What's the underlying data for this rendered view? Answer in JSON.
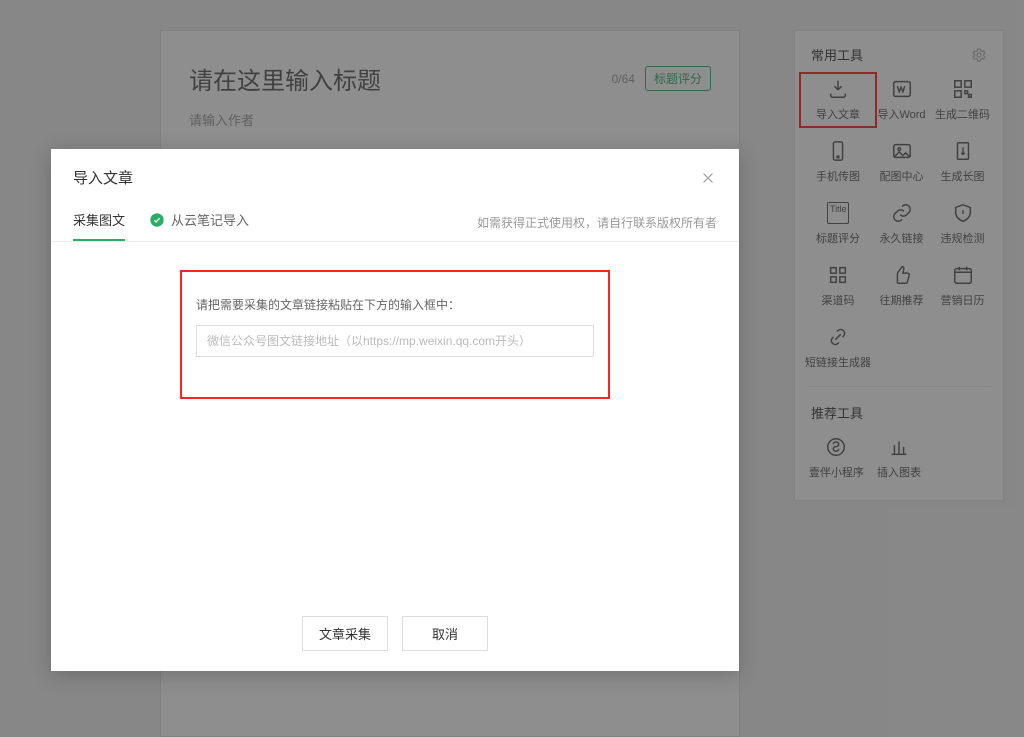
{
  "editor": {
    "title_placeholder": "请在这里输入标题",
    "author_placeholder": "请输入作者",
    "char_count": "0/64",
    "title_score_btn": "标题评分"
  },
  "sidebar": {
    "common_title": "常用工具",
    "recommend_title": "推荐工具",
    "tools": {
      "import_article": "导入文章",
      "import_word": "导入Word",
      "gen_qr": "生成二维码",
      "phone_upload": "手机传图",
      "image_center": "配图中心",
      "gen_long_image": "生成长图",
      "title_score": "标题评分",
      "perm_link": "永久链接",
      "violation_check": "违规检测",
      "channel_code": "渠道码",
      "past_recommend": "往期推荐",
      "marketing_calendar": "营销日历",
      "short_link_gen": "短链接生成器",
      "yiban_miniprogram": "壹伴小程序",
      "insert_chart": "插入图表"
    }
  },
  "modal": {
    "title": "导入文章",
    "tabs": {
      "collect": "采集图文",
      "import_note": "从云笔记导入"
    },
    "rights_hint": "如需获得正式使用权，请自行联系版权所有者",
    "collect_label": "请把需要采集的文章链接粘贴在下方的输入框中：",
    "collect_placeholder": "微信公众号图文链接地址（以https://mp.weixin.qq.com开头）",
    "url_value": "",
    "btn_collect": "文章采集",
    "btn_cancel": "取消"
  }
}
